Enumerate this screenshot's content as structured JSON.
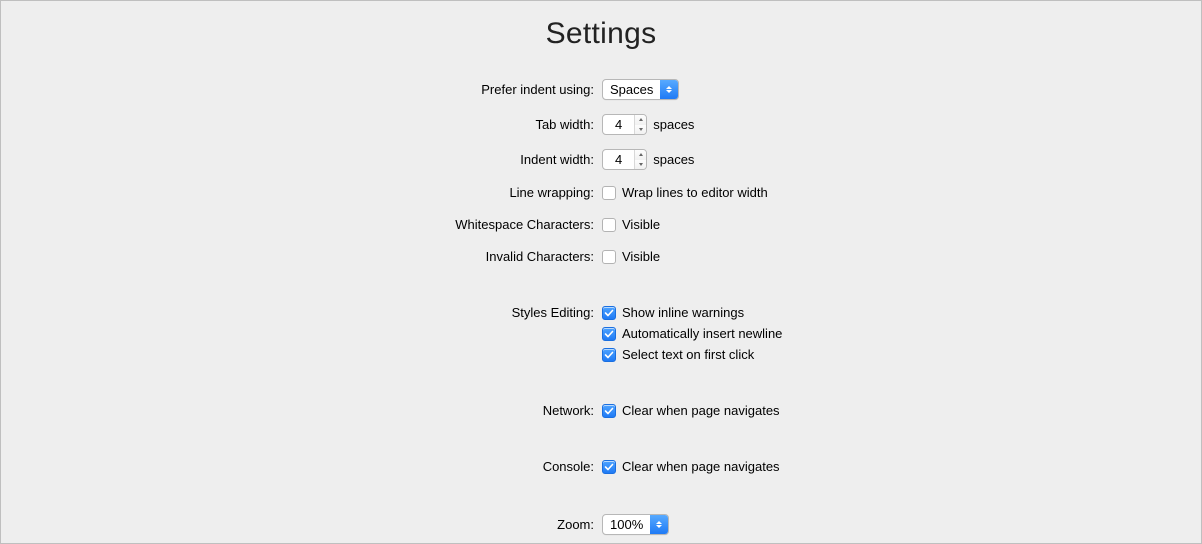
{
  "title": "Settings",
  "rows": {
    "indentUsing": {
      "label": "Prefer indent using:",
      "value": "Spaces"
    },
    "tabWidth": {
      "label": "Tab width:",
      "value": "4",
      "suffix": "spaces"
    },
    "indentWidth": {
      "label": "Indent width:",
      "value": "4",
      "suffix": "spaces"
    },
    "lineWrap": {
      "label": "Line wrapping:",
      "checked": false,
      "text": "Wrap lines to editor width"
    },
    "whitespace": {
      "label": "Whitespace Characters:",
      "checked": false,
      "text": "Visible"
    },
    "invalid": {
      "label": "Invalid Characters:",
      "checked": false,
      "text": "Visible"
    },
    "styles": {
      "label": "Styles Editing:",
      "items": [
        {
          "checked": true,
          "text": "Show inline warnings"
        },
        {
          "checked": true,
          "text": "Automatically insert newline"
        },
        {
          "checked": true,
          "text": "Select text on first click"
        }
      ]
    },
    "network": {
      "label": "Network:",
      "checked": true,
      "text": "Clear when page navigates"
    },
    "console": {
      "label": "Console:",
      "checked": true,
      "text": "Clear when page navigates"
    },
    "zoom": {
      "label": "Zoom:",
      "value": "100%"
    }
  }
}
